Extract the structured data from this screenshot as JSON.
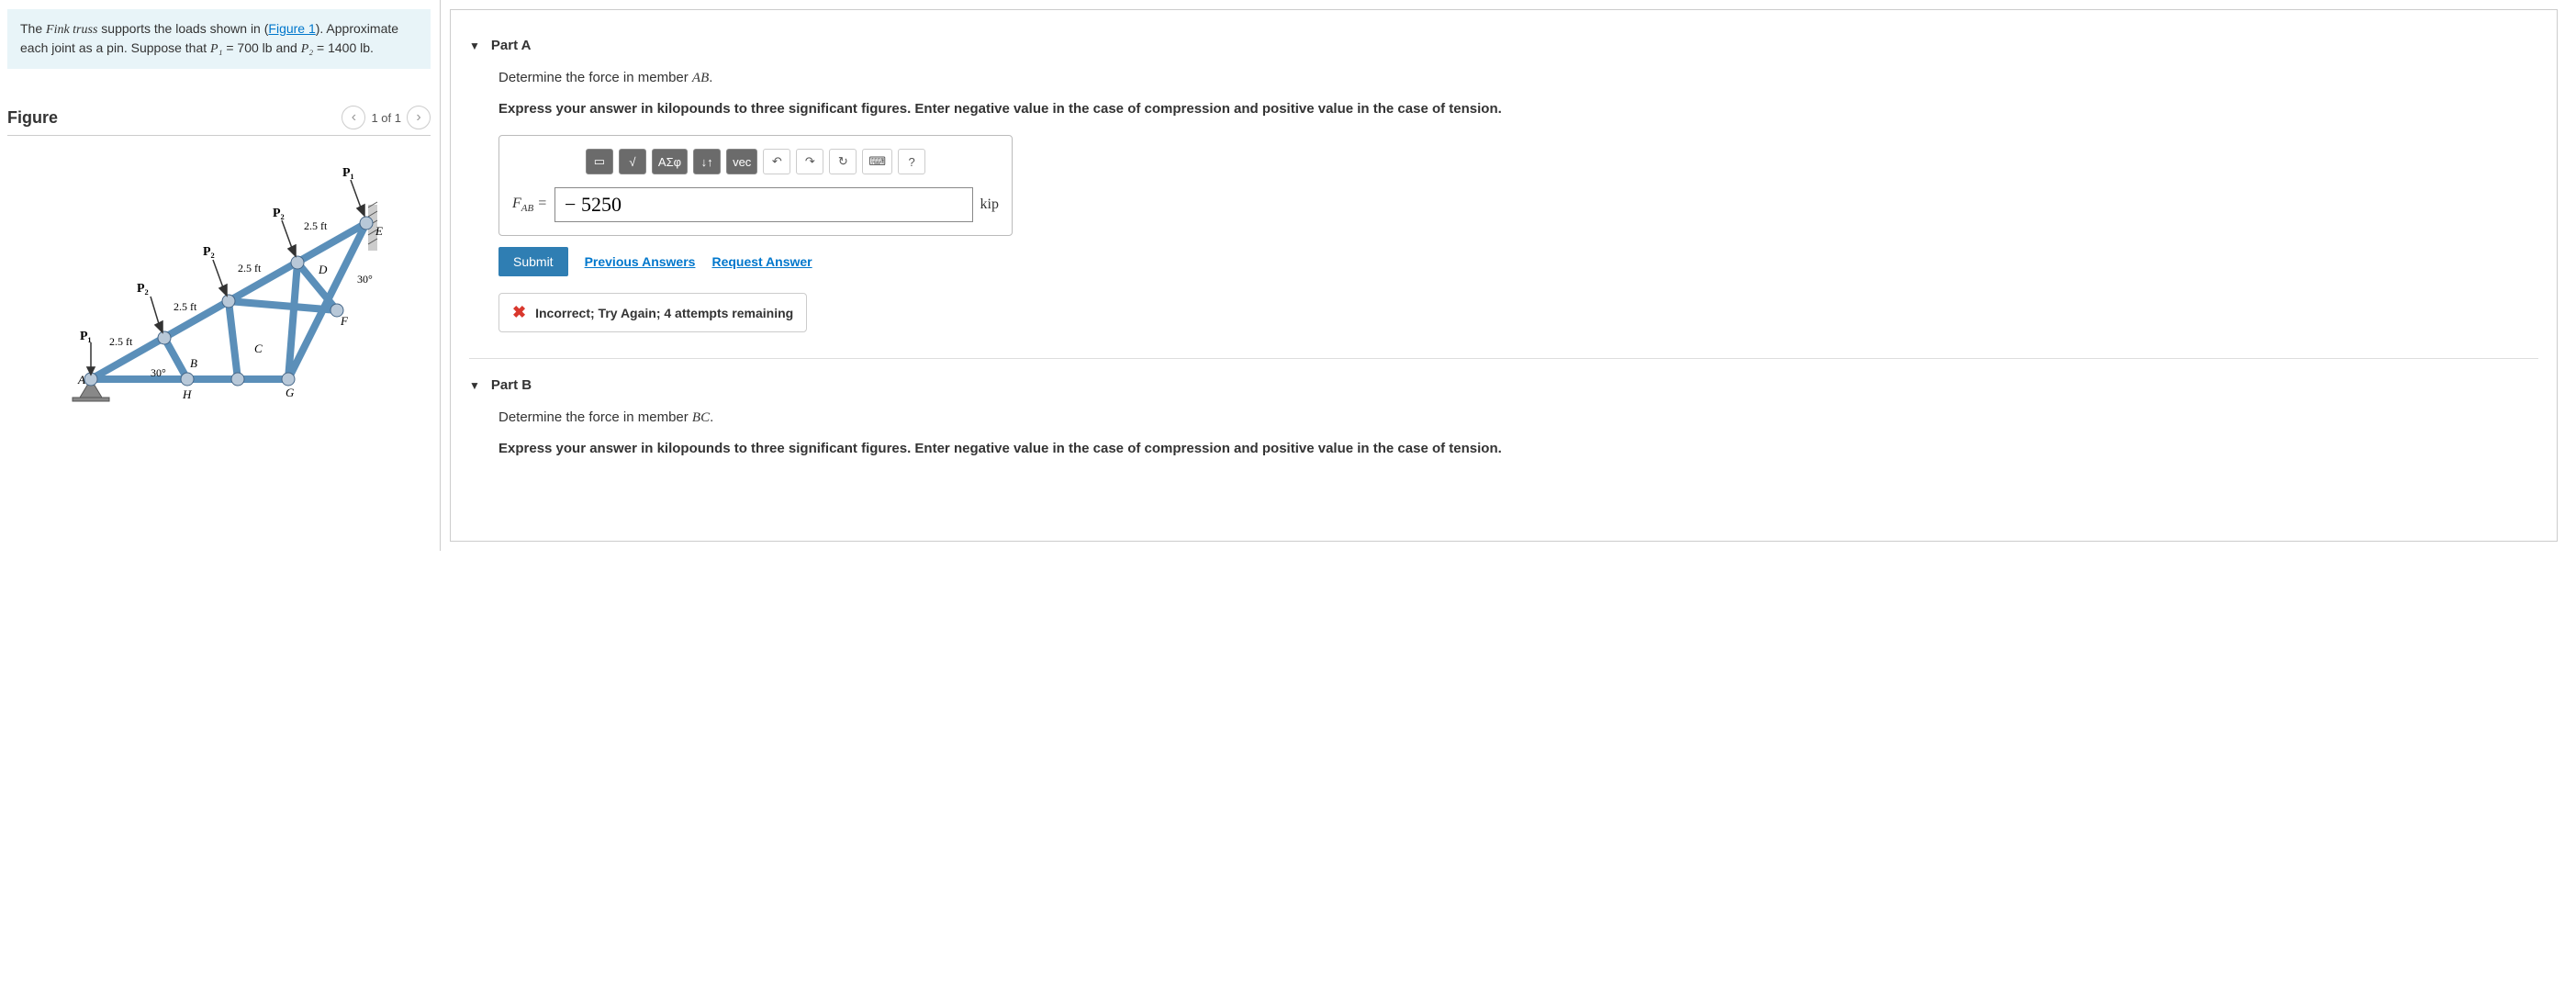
{
  "problem": {
    "text_prefix": "The ",
    "fink": "Fink truss",
    "text_mid1": " supports the loads shown in (",
    "figlink": "Figure 1",
    "text_mid2": "). Approximate each joint as a pin. Suppose that ",
    "p1var": "P₁",
    "p1eq": " = 700 lb and ",
    "p2var": "P₂",
    "p2eq": " = 1400 lb."
  },
  "figure": {
    "title": "Figure",
    "counter": "1 of 1",
    "labels": {
      "P1a": "P₁",
      "P1b": "P₁",
      "P2a": "P₂",
      "P2b": "P₂",
      "P2c": "P₂",
      "d1": "2.5 ft",
      "d2": "2.5 ft",
      "d3": "2.5 ft",
      "d4": "2.5 ft",
      "ang1": "30°",
      "ang2": "30°",
      "A": "A",
      "B": "B",
      "C": "C",
      "D": "D",
      "E": "E",
      "F": "F",
      "G": "G",
      "H": "H"
    }
  },
  "partA": {
    "title": "Part A",
    "question_pre": "Determine the force in member ",
    "member": "AB",
    "question_post": ".",
    "instruction": "Express your answer in kilopounds to three significant figures. Enter negative value in the case of compression and positive value in the case of tension.",
    "toolbar": {
      "sqrt": "√",
      "greek": "ΑΣφ",
      "arrows": "↓↑",
      "vec": "vec",
      "undo": "↶",
      "redo": "↷",
      "reset": "↻",
      "kbd": "⌨",
      "help": "?"
    },
    "var": "F",
    "sub": "AB",
    "eq": " = ",
    "value": "− 5250",
    "unit": "kip",
    "submit": "Submit",
    "prev": "Previous Answers",
    "req": "Request Answer",
    "feedback": "Incorrect; Try Again; 4 attempts remaining"
  },
  "partB": {
    "title": "Part B",
    "question_pre": "Determine the force in member ",
    "member": "BC",
    "question_post": ".",
    "instruction": "Express your answer in kilopounds to three significant figures. Enter negative value in the case of compression and positive value in the case of tension."
  }
}
